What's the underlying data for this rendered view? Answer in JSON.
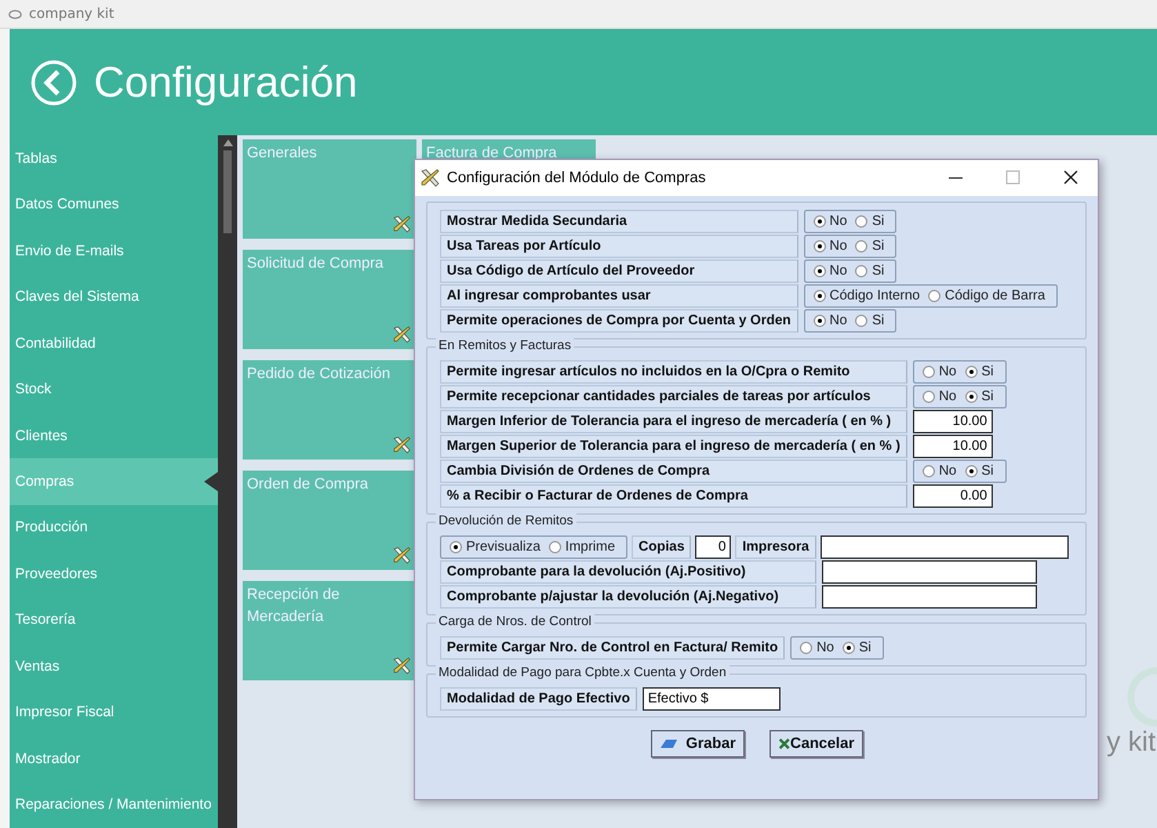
{
  "window": {
    "title": "company kit"
  },
  "header": {
    "title": "Configuración"
  },
  "sidebar": {
    "items": [
      {
        "label": "Tablas",
        "selected": false
      },
      {
        "label": "Datos Comunes",
        "selected": false
      },
      {
        "label": "Envio de E-mails",
        "selected": false
      },
      {
        "label": "Claves del Sistema",
        "selected": false
      },
      {
        "label": "Contabilidad",
        "selected": false
      },
      {
        "label": "Stock",
        "selected": false
      },
      {
        "label": "Clientes",
        "selected": false
      },
      {
        "label": "Compras",
        "selected": true
      },
      {
        "label": "Producción",
        "selected": false
      },
      {
        "label": "Proveedores",
        "selected": false
      },
      {
        "label": "Tesorería",
        "selected": false
      },
      {
        "label": "Ventas",
        "selected": false
      },
      {
        "label": "Impresor Fiscal",
        "selected": false
      },
      {
        "label": "Mostrador",
        "selected": false
      },
      {
        "label": "Reparaciones / Mantenimiento",
        "selected": false
      }
    ]
  },
  "tiles": [
    {
      "label": "Generales"
    },
    {
      "label": "Solicitud de Compra"
    },
    {
      "label": "Pedido de Cotización"
    },
    {
      "label": "Orden de Compra"
    },
    {
      "label": "Recepción de Mercadería"
    }
  ],
  "tiles_column_2": [
    {
      "label": "Factura de Compra"
    }
  ],
  "logo_fragment": "y kit",
  "dialog": {
    "title": "Configuración del Módulo de Compras",
    "sections": [
      {
        "rows": [
          {
            "kind": "radio",
            "label": "Mostrar Medida Secundaria",
            "options": [
              {
                "label": "No",
                "selected": true
              },
              {
                "label": "Si",
                "selected": false
              }
            ]
          },
          {
            "kind": "radio",
            "label": "Usa Tareas por Artículo",
            "options": [
              {
                "label": "No",
                "selected": true
              },
              {
                "label": "Si",
                "selected": false
              }
            ]
          },
          {
            "kind": "radio",
            "label": "Usa Código de Artículo del Proveedor",
            "options": [
              {
                "label": "No",
                "selected": true
              },
              {
                "label": "Si",
                "selected": false
              }
            ]
          },
          {
            "kind": "radio",
            "label": "Al ingresar comprobantes usar",
            "options": [
              {
                "label": "Código Interno",
                "selected": true
              },
              {
                "label": "Código de Barra",
                "selected": false
              }
            ]
          },
          {
            "kind": "radio",
            "label": "Permite operaciones de Compra por Cuenta y Orden",
            "options": [
              {
                "label": "No",
                "selected": true
              },
              {
                "label": "Si",
                "selected": false
              }
            ]
          }
        ]
      },
      {
        "legend": "En Remitos y Facturas",
        "rows": [
          {
            "kind": "radio",
            "label": "Permite ingresar artículos no incluidos en la O/Cpra o Remito",
            "options": [
              {
                "label": "No",
                "selected": false
              },
              {
                "label": "Si",
                "selected": true
              }
            ]
          },
          {
            "kind": "radio",
            "label": "Permite recepcionar cantidades parciales de tareas por artículos",
            "options": [
              {
                "label": "No",
                "selected": false
              },
              {
                "label": "Si",
                "selected": true
              }
            ]
          },
          {
            "kind": "number",
            "label": "Margen Inferior de Tolerancia para el ingreso de mercadería ( en % )",
            "value": "10.00"
          },
          {
            "kind": "number",
            "label": "Margen Superior de Tolerancia para el ingreso de mercadería ( en % )",
            "value": "10.00"
          },
          {
            "kind": "radio",
            "label": "Cambia División de Ordenes de Compra",
            "options": [
              {
                "label": "No",
                "selected": false
              },
              {
                "label": "Si",
                "selected": true
              }
            ]
          },
          {
            "kind": "number",
            "label": "% a Recibir o Facturar de Ordenes de Compra",
            "value": "0.00"
          }
        ]
      },
      {
        "legend": "Devolución de Remitos",
        "rows": [
          {
            "kind": "print",
            "options": [
              {
                "label": "Previsualiza",
                "selected": true
              },
              {
                "label": "Imprime",
                "selected": false
              }
            ],
            "copies_label": "Copias",
            "copies_value": "0",
            "printer_label": "Impresora"
          },
          {
            "kind": "text",
            "label": "Comprobante para la devolución (Aj.Positivo)"
          },
          {
            "kind": "text",
            "label": "Comprobante p/ajustar la devolución (Aj.Negativo)"
          }
        ]
      },
      {
        "legend": "Carga de Nros. de Control",
        "rows": [
          {
            "kind": "radio",
            "label": "Permite Cargar Nro. de Control en Factura/ Remito",
            "options": [
              {
                "label": "No",
                "selected": false
              },
              {
                "label": "Si",
                "selected": true
              }
            ]
          }
        ]
      },
      {
        "legend": "Modalidad de Pago para Cpbte.x Cuenta y Orden",
        "rows": [
          {
            "kind": "text",
            "label": "Modalidad de Pago Efectivo",
            "value": "Efectivo $"
          }
        ]
      }
    ],
    "buttons": [
      {
        "kind": "save",
        "label": "Grabar"
      },
      {
        "kind": "cancel",
        "label": "Cancelar"
      }
    ]
  }
}
